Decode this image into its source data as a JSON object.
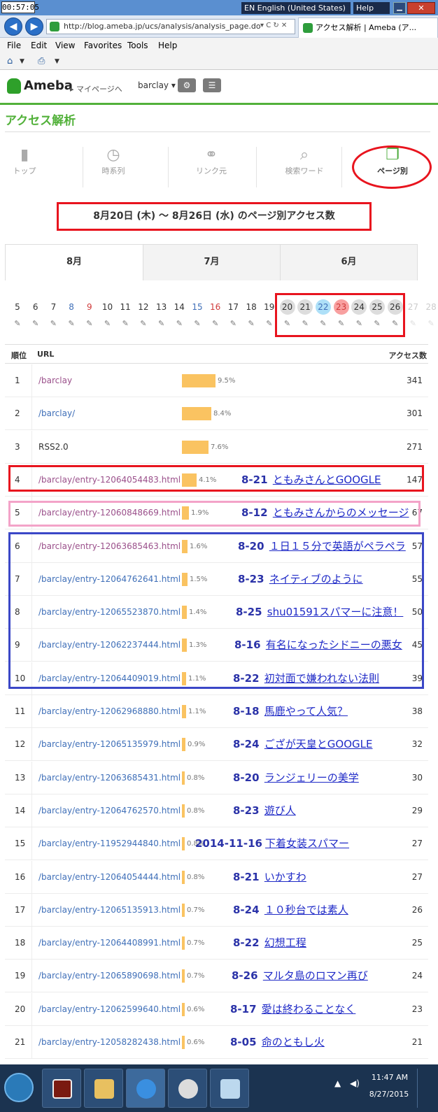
{
  "window": {
    "clock": "00:57:05",
    "language": "EN English (United States)",
    "help": "Help",
    "minimize": "▁",
    "close": "✕"
  },
  "browser": {
    "back": "◀",
    "forward": "▶",
    "address": "http://blog.ameba.jp/ucs/analysis/analysis_page.do",
    "addr_controls": "▾ C ↻ ✕",
    "tab_title": "アクセス解析 | Ameba (ア..."
  },
  "menu": [
    "File",
    "Edit",
    "View",
    "Favorites",
    "Tools",
    "Help"
  ],
  "commands": {
    "home": "⌂",
    "print": "⎙"
  },
  "header": {
    "logo": "Ameba",
    "mypage": "▸ マイページへ",
    "user": "barclay ▾",
    "settings": "⚙",
    "menu": "☰"
  },
  "section_title": "アクセス解析",
  "nav": [
    {
      "label": "トップ",
      "icon": "bar-chart-icon"
    },
    {
      "label": "時系列",
      "icon": "clock-icon"
    },
    {
      "label": "リンク元",
      "icon": "link-icon"
    },
    {
      "label": "検索ワード",
      "icon": "search-icon"
    },
    {
      "label": "ページ別",
      "icon": "pages-icon"
    }
  ],
  "range_text": "8月20日 (木) ～ 8月26日 (水) のページ別アクセス数",
  "month_tabs": [
    "8月",
    "7月",
    "6月"
  ],
  "days": [
    "5",
    "6",
    "7",
    "8",
    "9",
    "10",
    "11",
    "12",
    "13",
    "14",
    "15",
    "16",
    "17",
    "18",
    "19",
    "20",
    "21",
    "22",
    "23",
    "24",
    "25",
    "26",
    "27",
    "28"
  ],
  "day_colors": {
    "8": "#3f6fb8",
    "9": "#d03b3b",
    "15": "#3f6fb8",
    "16": "#d03b3b",
    "22": "#3f6fb8",
    "23": "#d03b3b"
  },
  "table": {
    "head_rank": "順位",
    "head_url": "URL",
    "head_count": "アクセス数",
    "rows": [
      {
        "rank": "1",
        "url": "/barclay",
        "pct": "9.5%",
        "share": 0.095,
        "count": "341",
        "note_date": "",
        "note_title": "",
        "style": "visited"
      },
      {
        "rank": "2",
        "url": "/barclay/",
        "pct": "8.4%",
        "share": 0.084,
        "count": "301",
        "note_date": "",
        "note_title": "",
        "style": "link"
      },
      {
        "rank": "3",
        "url": "RSS2.0",
        "pct": "7.6%",
        "share": 0.076,
        "count": "271",
        "note_date": "",
        "note_title": "",
        "style": "plain"
      },
      {
        "rank": "4",
        "url": "/barclay/entry-12064054483.html",
        "pct": "4.1%",
        "share": 0.041,
        "count": "147",
        "note_date": "8-21",
        "note_title": "ともみさんとGOOGLE",
        "style": "visited"
      },
      {
        "rank": "5",
        "url": "/barclay/entry-12060848669.html",
        "pct": "1.9%",
        "share": 0.019,
        "count": "67",
        "note_date": "8-12",
        "note_title": "ともみさんからのメッセージ",
        "style": "visited"
      },
      {
        "rank": "6",
        "url": "/barclay/entry-12063685463.html",
        "pct": "1.6%",
        "share": 0.016,
        "count": "57",
        "note_date": "8-20",
        "note_title": "１日１５分で英語がペラペラ",
        "style": "visited"
      },
      {
        "rank": "7",
        "url": "/barclay/entry-12064762641.html",
        "pct": "1.5%",
        "share": 0.015,
        "count": "55",
        "note_date": "8-23",
        "note_title": "ネイティブのように",
        "style": "link"
      },
      {
        "rank": "8",
        "url": "/barclay/entry-12065523870.html",
        "pct": "1.4%",
        "share": 0.014,
        "count": "50",
        "note_date": "8-25",
        "note_title": "shu01591スパマーに注意！",
        "style": "link"
      },
      {
        "rank": "9",
        "url": "/barclay/entry-12062237444.html",
        "pct": "1.3%",
        "share": 0.013,
        "count": "45",
        "note_date": "8-16",
        "note_title": "有名になったシドニーの悪女",
        "style": "link"
      },
      {
        "rank": "10",
        "url": "/barclay/entry-12064409019.html",
        "pct": "1.1%",
        "share": 0.011,
        "count": "39",
        "note_date": "8-22",
        "note_title": "初対面で嫌われない法則",
        "style": "link"
      },
      {
        "rank": "11",
        "url": "/barclay/entry-12062968880.html",
        "pct": "1.1%",
        "share": 0.011,
        "count": "38",
        "note_date": "8-18",
        "note_title": "馬鹿やって人気？",
        "style": "link"
      },
      {
        "rank": "12",
        "url": "/barclay/entry-12065135979.html",
        "pct": "0.9%",
        "share": 0.009,
        "count": "32",
        "note_date": "8-24",
        "note_title": "ござが天皇とGOOGLE",
        "style": "link"
      },
      {
        "rank": "13",
        "url": "/barclay/entry-12063685431.html",
        "pct": "0.8%",
        "share": 0.008,
        "count": "30",
        "note_date": "8-20",
        "note_title": "ランジェリーの美学",
        "style": "link"
      },
      {
        "rank": "14",
        "url": "/barclay/entry-12064762570.html",
        "pct": "0.8%",
        "share": 0.008,
        "count": "29",
        "note_date": "8-23",
        "note_title": "遊び人",
        "style": "link"
      },
      {
        "rank": "15",
        "url": "/barclay/entry-11952944840.html",
        "pct": "0.8%",
        "share": 0.008,
        "count": "27",
        "note_date": "2014-11-16",
        "note_title": "下着女装スパマー",
        "style": "link"
      },
      {
        "rank": "16",
        "url": "/barclay/entry-12064054444.html",
        "pct": "0.8%",
        "share": 0.008,
        "count": "27",
        "note_date": "8-21",
        "note_title": "いかすわ",
        "style": "link"
      },
      {
        "rank": "17",
        "url": "/barclay/entry-12065135913.html",
        "pct": "0.7%",
        "share": 0.007,
        "count": "26",
        "note_date": "8-24",
        "note_title": "１０秒台では素人",
        "style": "link"
      },
      {
        "rank": "18",
        "url": "/barclay/entry-12064408991.html",
        "pct": "0.7%",
        "share": 0.007,
        "count": "25",
        "note_date": "8-22",
        "note_title": "幻想工程",
        "style": "link"
      },
      {
        "rank": "19",
        "url": "/barclay/entry-12065890698.html",
        "pct": "0.7%",
        "share": 0.007,
        "count": "24",
        "note_date": "8-26",
        "note_title": "マルタ島のロマン再び",
        "style": "link"
      },
      {
        "rank": "20",
        "url": "/barclay/entry-12062599640.html",
        "pct": "0.6%",
        "share": 0.006,
        "count": "23",
        "note_date": "8-17",
        "note_title": "愛は終わることなく",
        "style": "link"
      },
      {
        "rank": "21",
        "url": "/barclay/entry-12058282438.html",
        "pct": "0.6%",
        "share": 0.006,
        "count": "21",
        "note_date": "8-05",
        "note_title": "命のともし火",
        "style": "link"
      }
    ]
  },
  "taskbar": {
    "time": "11:47 AM",
    "date": "8/27/2015",
    "tray_arrow": "▲",
    "volume": "◀)"
  }
}
